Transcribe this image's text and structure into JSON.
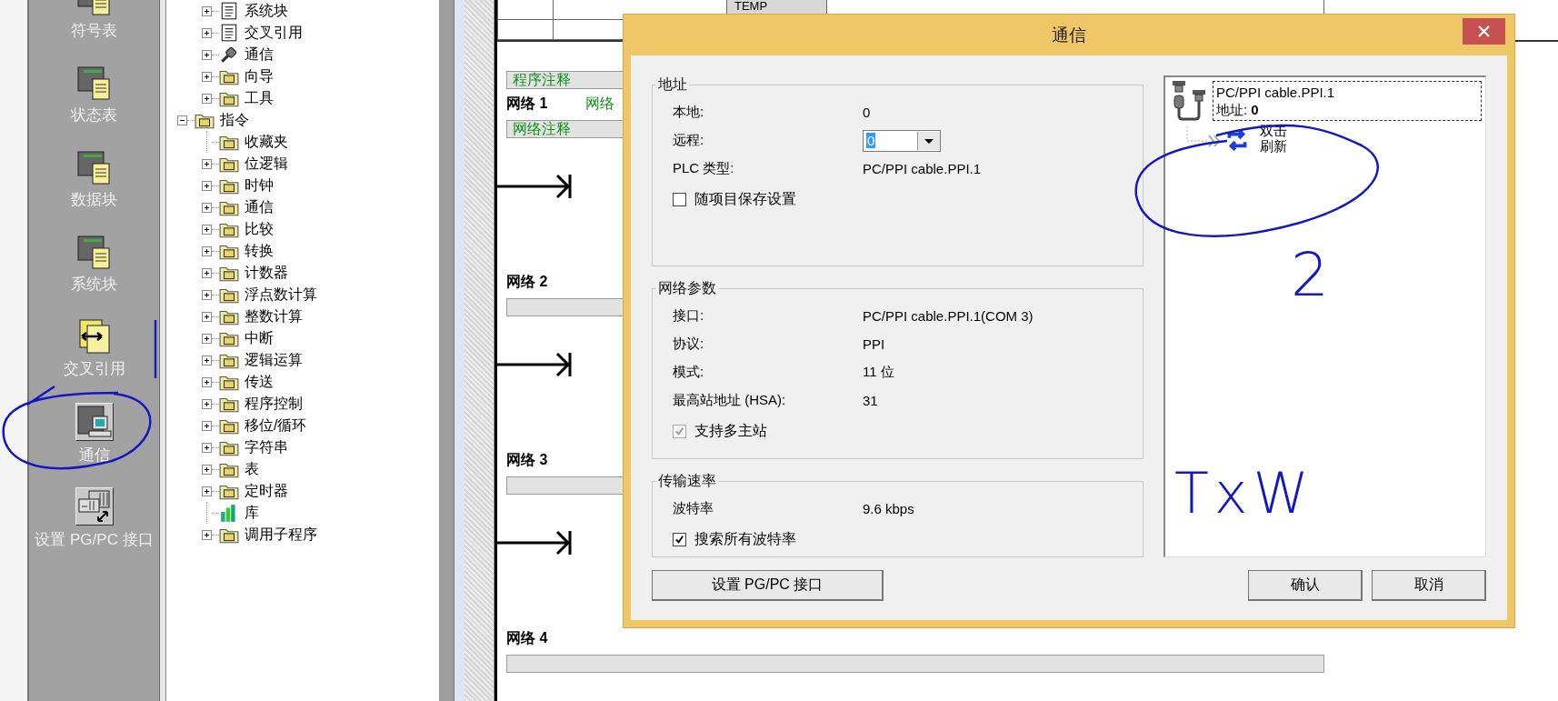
{
  "navigation_bar": {
    "items": [
      {
        "label": "符号表",
        "kind": "document"
      },
      {
        "label": "状态表",
        "kind": "document"
      },
      {
        "label": "数据块",
        "kind": "document"
      },
      {
        "label": "系统块",
        "kind": "document"
      },
      {
        "label": "交叉引用",
        "kind": "crossref"
      },
      {
        "label": "通信",
        "kind": "computer"
      },
      {
        "label": "设置 PG/PC 接口",
        "kind": "rack"
      }
    ]
  },
  "project_tree": {
    "scrolled_children": [
      {
        "label": "系统块",
        "kind": "page",
        "expanded": false
      },
      {
        "label": "交叉引用",
        "kind": "page",
        "expanded": false
      },
      {
        "label": "通信",
        "kind": "plug",
        "expanded": false
      },
      {
        "label": "向导",
        "kind": "folder",
        "expanded": false
      },
      {
        "label": "工具",
        "kind": "folder",
        "expanded": false
      }
    ],
    "items": [
      {
        "label": "指令",
        "kind": "folder",
        "expanded": true,
        "children": [
          {
            "label": "收藏夹",
            "kind": "folder"
          },
          {
            "label": "位逻辑",
            "kind": "folder",
            "expanded": false
          },
          {
            "label": "时钟",
            "kind": "folder",
            "expanded": false
          },
          {
            "label": "通信",
            "kind": "folder",
            "expanded": false
          },
          {
            "label": "比较",
            "kind": "folder",
            "expanded": false
          },
          {
            "label": "转换",
            "kind": "folder",
            "expanded": false
          },
          {
            "label": "计数器",
            "kind": "folder",
            "expanded": false
          },
          {
            "label": "浮点数计算",
            "kind": "folder",
            "expanded": false
          },
          {
            "label": "整数计算",
            "kind": "folder",
            "expanded": false
          },
          {
            "label": "中断",
            "kind": "folder",
            "expanded": false
          },
          {
            "label": "逻辑运算",
            "kind": "folder",
            "expanded": false
          },
          {
            "label": "传送",
            "kind": "folder",
            "expanded": false
          },
          {
            "label": "程序控制",
            "kind": "folder",
            "expanded": false
          },
          {
            "label": "移位/循环",
            "kind": "folder",
            "expanded": false
          },
          {
            "label": "字符串",
            "kind": "folder",
            "expanded": false
          },
          {
            "label": "表",
            "kind": "folder",
            "expanded": false
          },
          {
            "label": "定时器",
            "kind": "folder",
            "expanded": false
          },
          {
            "label": "库",
            "kind": "library"
          },
          {
            "label": "调用子程序",
            "kind": "folder",
            "expanded": false
          }
        ]
      }
    ]
  },
  "editor": {
    "var_table": {
      "cell": "TEMP"
    },
    "program_comment": "程序注释",
    "networks": [
      {
        "label": "网络 1",
        "title": "网络",
        "comment": "网络注释"
      },
      {
        "label": "网络 2"
      },
      {
        "label": "网络 3"
      },
      {
        "label": "网络 4"
      }
    ]
  },
  "dialog": {
    "title": "通信",
    "address": {
      "legend": "地址",
      "rows": [
        {
          "label": "本地:",
          "value": "0",
          "kind": "text"
        },
        {
          "label": "远程:",
          "value": "0",
          "kind": "dropdown"
        },
        {
          "label": "PLC 类型:",
          "value": "PC/PPI cable.PPI.1",
          "kind": "text"
        }
      ],
      "save_with_project": {
        "label": "随项目保存设置",
        "checked": false,
        "disabled": false
      }
    },
    "network": {
      "legend": "网络参数",
      "rows": [
        {
          "label": "接口:",
          "value": "PC/PPI cable.PPI.1(COM 3)",
          "kind": "text"
        },
        {
          "label": "协议:",
          "value": "PPI",
          "kind": "text"
        },
        {
          "label": "模式:",
          "value": "11 位",
          "kind": "text"
        },
        {
          "label": "最高站地址 (HSA):",
          "value": "31",
          "kind": "text"
        }
      ],
      "multi_master": {
        "label": "支持多主站",
        "checked": true,
        "disabled": true
      }
    },
    "baud": {
      "legend": "传输速率",
      "rows": [
        {
          "label": "波特率",
          "value": "9.6 kbps",
          "kind": "text"
        }
      ],
      "search_all": {
        "label": "搜索所有波特率",
        "checked": true,
        "disabled": false
      }
    },
    "device_panel": {
      "device_name": "PC/PPI cable.PPI.1",
      "address": "地址: **0**",
      "refresh_lines": [
        "双击",
        "刷新"
      ]
    },
    "buttons": {
      "set_interface": "设置 PG/PC 接口",
      "ok": "确认",
      "cancel": "取消"
    }
  },
  "handwriting": [
    "2",
    "TxW"
  ]
}
